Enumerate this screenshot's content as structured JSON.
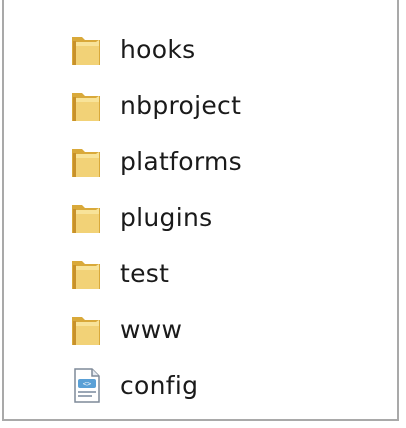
{
  "items": [
    {
      "label": "hooks",
      "icon": "folder-icon"
    },
    {
      "label": "nbproject",
      "icon": "folder-icon"
    },
    {
      "label": "platforms",
      "icon": "folder-icon"
    },
    {
      "label": "plugins",
      "icon": "folder-icon"
    },
    {
      "label": "test",
      "icon": "folder-icon"
    },
    {
      "label": "www",
      "icon": "folder-icon"
    },
    {
      "label": "config",
      "icon": "xml-file-icon"
    }
  ],
  "colors": {
    "folder_back": "#d9a93a",
    "folder_front": "#f2d277",
    "folder_highlight": "#fbe9a8",
    "border": "#a9a9a9"
  }
}
